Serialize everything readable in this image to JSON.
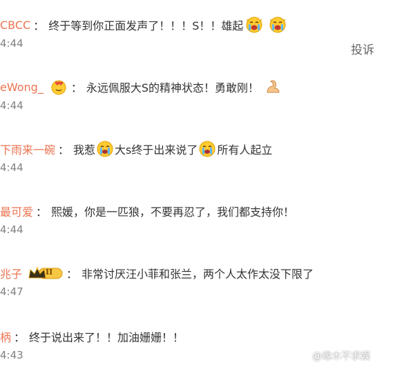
{
  "comments": [
    {
      "user": "CBCC",
      "sep": "：",
      "text_parts": [
        "终于等到你正面发声了！！！S！！雄起"
      ],
      "time": "4:44"
    },
    {
      "user": "eWong_",
      "sep": "：",
      "text_parts": [
        "永远佩服大S的精神状态！勇敢刚！"
      ],
      "time": "4:44"
    },
    {
      "user": "下雨来一碗",
      "sep": "：",
      "text_parts": [
        "我惹",
        "大s终于出来说了",
        "所有人起立"
      ],
      "time": "4:44"
    },
    {
      "user": "最可爱",
      "sep": "：",
      "text_parts": [
        "熙媛，你是一匹狼，不要再忍了，我们都支持你！"
      ],
      "time": "4:44"
    },
    {
      "user": "兆子",
      "sep": "：",
      "text_parts": [
        "非常讨厌汪小菲和张兰，两个人太作太没下限了"
      ],
      "time": "4:47",
      "badge_text": "II"
    },
    {
      "user": "柄",
      "sep": "：",
      "text_parts": [
        "终于说出来了！！加油姗姗！！"
      ],
      "time": "4:43"
    }
  ],
  "report_label": "投诉",
  "watermark": "@缘木不求娱",
  "colors": {
    "username": "#eb7350",
    "text": "#333333",
    "time": "#808080"
  },
  "icons": [
    "cheering-emoji-icon",
    "heart-face-icon",
    "flexed-biceps-icon",
    "crying-emoji-icon",
    "crown-badge-icon"
  ]
}
